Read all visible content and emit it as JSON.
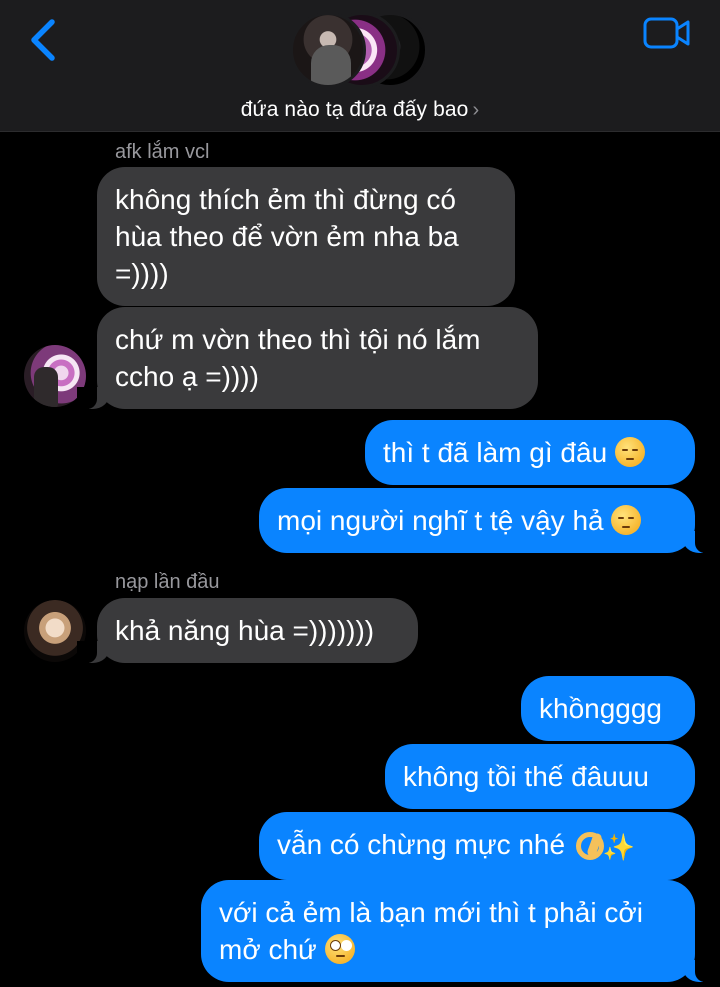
{
  "header": {
    "title": "đứa nào tạ đứa đấy bao",
    "chevron": "›",
    "icons": {
      "back": "chevron-left-icon",
      "video": "video-camera-icon"
    },
    "accent": "#0a84ff"
  },
  "messages": [
    {
      "id": "m1",
      "direction": "incoming",
      "sender": "afk lắm vcl",
      "text": "không thích ẻm thì đừng có hùa theo để vờn ẻm nha ba =))))"
    },
    {
      "id": "m2",
      "direction": "incoming",
      "text": "chứ m vờn theo thì tội nó lắm ccho ạ =))))"
    },
    {
      "id": "m3",
      "direction": "outgoing",
      "text": "thì t đã làm gì đâu",
      "emoji": "pensive-face"
    },
    {
      "id": "m4",
      "direction": "outgoing",
      "text": "mọi người nghĩ t tệ vậy hả",
      "emoji": "pensive-face"
    },
    {
      "id": "m5",
      "direction": "incoming",
      "sender": "nạp lần đầu",
      "text": "khả năng hùa =)))))))"
    },
    {
      "id": "m6",
      "direction": "outgoing",
      "text": "khồngggg"
    },
    {
      "id": "m7",
      "direction": "outgoing",
      "text": "không tồi thế đâuuu"
    },
    {
      "id": "m8",
      "direction": "outgoing",
      "text": "vẫn có chừng mực nhé",
      "emoji": "ok-hand+sparkles"
    },
    {
      "id": "m9",
      "direction": "outgoing",
      "text": "với cả ẻm là bạn mới thì t phải cởi mở chứ",
      "emoji": "rolling-eyes-face"
    }
  ],
  "colors": {
    "incoming_bubble": "#3a3a3c",
    "outgoing_bubble": "#0a84ff",
    "background": "#000000",
    "header_bg": "#1c1c1e"
  }
}
